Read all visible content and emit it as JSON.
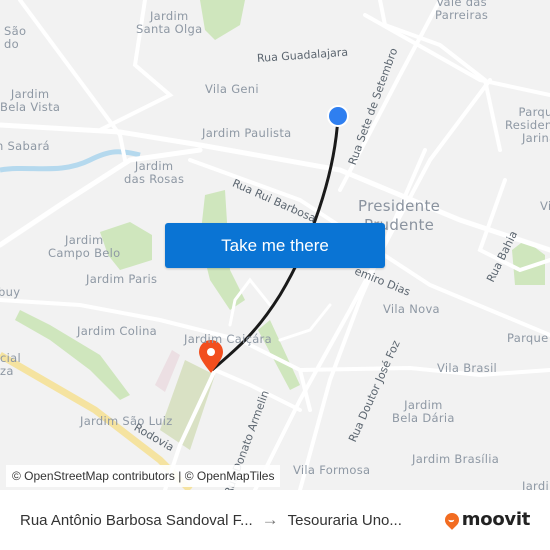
{
  "map": {
    "neighborhoods": [
      {
        "id": "sao-do",
        "text": "São\ndo"
      },
      {
        "id": "jardim-santa-olga",
        "text": "Jardim\nSanta Olga"
      },
      {
        "id": "vale-das-parreiras",
        "text": "Vale das\nParreiras"
      },
      {
        "id": "jardim-bela-vista",
        "text": "Jardim\nBela Vista"
      },
      {
        "id": "vila-geni",
        "text": "Vila Geni"
      },
      {
        "id": "parque-residencial-jarina",
        "text": "Parque\nResidencial\nJarinã"
      },
      {
        "id": "jardim-sabara",
        "text": "n Sabará"
      },
      {
        "id": "jardim-paulista",
        "text": "Jardim Paulista"
      },
      {
        "id": "jardim-das-rosas",
        "text": "Jardim\ndas Rosas"
      },
      {
        "id": "presidente-prudente",
        "text": "Presidente\nPrudente"
      },
      {
        "id": "vi",
        "text": "Vi"
      },
      {
        "id": "jardim-campo-belo",
        "text": "Jardim\nCampo Belo"
      },
      {
        "id": "jardim-paris",
        "text": "Jardim Paris"
      },
      {
        "id": "buy",
        "text": "buy"
      },
      {
        "id": "jardim-colina",
        "text": "Jardim Colina"
      },
      {
        "id": "jardim-caicara",
        "text": "Jardim Caiçára"
      },
      {
        "id": "vila-nova",
        "text": "Vila Nova"
      },
      {
        "id": "parque",
        "text": "Parque"
      },
      {
        "id": "residencial-za",
        "text": "cial\nza"
      },
      {
        "id": "vila-brasil",
        "text": "Vila Brasil"
      },
      {
        "id": "jardim-bela-daria",
        "text": "Jardim\nBela Dária"
      },
      {
        "id": "jardim-sao-luiz",
        "text": "Jardim São Luiz"
      },
      {
        "id": "jardim-brasilia",
        "text": "Jardim Brasília"
      },
      {
        "id": "vila-formosa",
        "text": "Vila Formosa"
      },
      {
        "id": "jardi",
        "text": "Jardi"
      }
    ],
    "streets": [
      {
        "id": "rua-guadalajara",
        "text": "Rua Guadalajara"
      },
      {
        "id": "rua-sete-de-setembro",
        "text": "Rua Sete de Setembro"
      },
      {
        "id": "rua-rui-barbosa",
        "text": "Rua Rui Barbosa"
      },
      {
        "id": "rua-casemiro-dias",
        "text": "emiro Dias"
      },
      {
        "id": "rua-bahia",
        "text": "Rua Bahia"
      },
      {
        "id": "rua-doutor-jose-foz",
        "text": "Rua Doutor José Foz"
      },
      {
        "id": "rua-donato-armelin",
        "text": "Rua Donato Armelin"
      },
      {
        "id": "rodovia",
        "text": "Rodovia"
      }
    ],
    "route_color": "#1a1a1a",
    "origin_marker_color": "#2f7ff0",
    "destination_marker_color": "#f24e1e",
    "attribution": "© OpenStreetMap contributors | © OpenMapTiles"
  },
  "cta": {
    "label": "Take me there",
    "color": "#0a74d4"
  },
  "footer": {
    "origin": "Rua Antônio Barbosa Sandoval F...",
    "arrow": "→",
    "destination": "Tesouraria Uno...",
    "brand": "moovit",
    "brand_color": "#f26c21"
  }
}
